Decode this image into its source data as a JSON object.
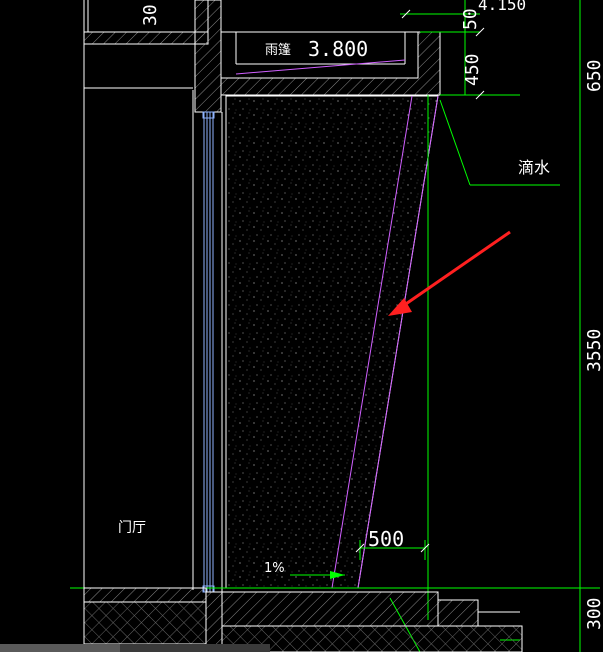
{
  "drawing": {
    "labels": {
      "canopy_label": "雨篷",
      "canopy_elevation": "3.800",
      "drip_label": "滴水",
      "hall_label": "门厅",
      "slope_label": "1%"
    },
    "dimensions": {
      "top_left": "30",
      "top_elev": "4.150",
      "top_50": "50",
      "d450": "450",
      "right_650": "650",
      "right_3550": "3550",
      "bottom_500": "500",
      "right_300": "300"
    },
    "colors": {
      "background": "#000000",
      "wall": "#ffffff",
      "glass": "#8fb4ff",
      "green": "#00ff00",
      "magenta": "#d060ff",
      "arrow": "#ff2020",
      "hatch": "#7a7a7a",
      "text": "#ffffff"
    },
    "annotations": {
      "arrow": "red-pointer-arrow"
    }
  }
}
